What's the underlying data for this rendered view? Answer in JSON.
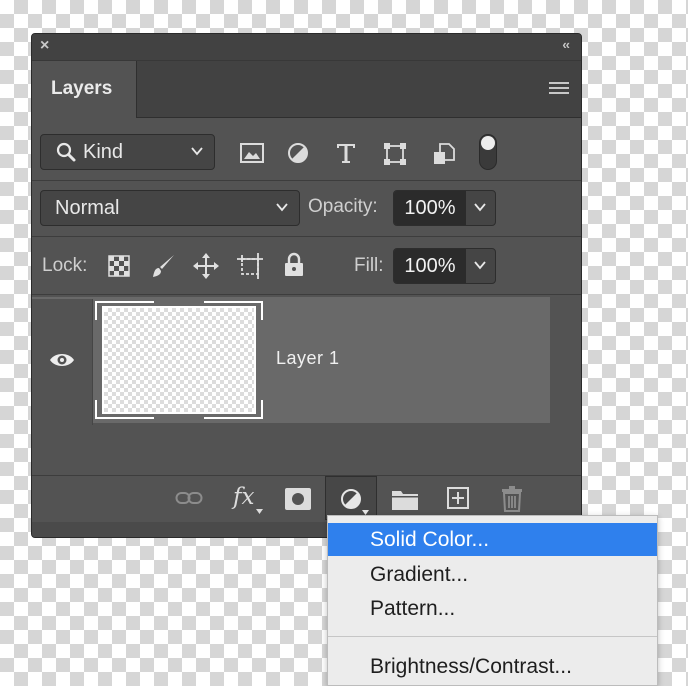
{
  "panel": {
    "close_label": "×",
    "collapse_label": "‹‹",
    "tab_title": "Layers",
    "menu_icon": "hamburger-icon"
  },
  "filter": {
    "kind_label": "Kind",
    "icons": [
      "image-filter-icon",
      "adjustment-filter-icon",
      "type-filter-icon",
      "shape-filter-icon",
      "smart-object-filter-icon"
    ]
  },
  "blend": {
    "mode": "Normal",
    "opacity_label": "Opacity:",
    "opacity_value": "100%"
  },
  "lock": {
    "label": "Lock:",
    "fill_label": "Fill:",
    "fill_value": "100%"
  },
  "layers": [
    {
      "name": "Layer 1",
      "visible": true
    }
  ],
  "bottom_toolbar": {
    "fx_label": "fx"
  },
  "adjustment_menu": {
    "items": [
      "Solid Color...",
      "Gradient...",
      "Pattern...",
      "Brightness/Contrast..."
    ],
    "highlighted_index": 0
  },
  "colors": {
    "panel_bg": "#535353",
    "selected_layer_bg": "#696969",
    "menu_highlight": "#2f80ed"
  }
}
